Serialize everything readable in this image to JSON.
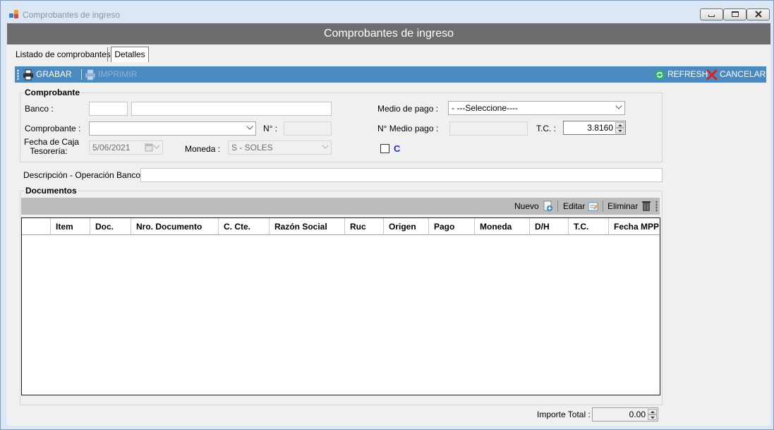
{
  "window": {
    "title": "Comprobantes de ingreso",
    "header": "Comprobantes de ingreso"
  },
  "tabs": {
    "listado": "Listado de comprobantes",
    "detalles": "Detalles"
  },
  "toolbar": {
    "grabar": "GRABAR",
    "imprimir": "IMPRIMIR",
    "refresh": "REFRESH",
    "cancelar": "CANCELAR"
  },
  "comprobante_group": {
    "title": "Comprobante",
    "banco_label": "Banco :",
    "banco_code": "",
    "banco_name": "",
    "comprobante_label": "Comprobante :",
    "comprobante_value": "",
    "numero_label": "N° :",
    "numero_value": "",
    "fecha_label_1": "Fecha de Caja",
    "fecha_label_2": "Tesorería:",
    "fecha_value": "5/06/2021",
    "moneda_label": "Moneda :",
    "moneda_value": "S - SOLES",
    "medio_pago_label": "Medio de pago :",
    "medio_pago_value": "- ---Seleccione----",
    "nro_medio_pago_label": "N° Medio pago :",
    "nro_medio_pago_value": "",
    "tc_label": "T.C. :",
    "tc_value": "3.8160",
    "c_checkbox_label": "C",
    "c_checked": false
  },
  "descripcion": {
    "label": "Descripción - Operación Banco:",
    "value": ""
  },
  "documentos": {
    "title": "Documentos",
    "nuevo": "Nuevo",
    "editar": "Editar",
    "eliminar": "Eliminar",
    "columns": [
      "Item",
      "Doc.",
      "Nro. Documento",
      "C. Cte.",
      "Razón Social",
      "Ruc",
      "Origen",
      "Pago",
      "Moneda",
      "D/H",
      "T.C.",
      "Fecha MPP"
    ],
    "rows": []
  },
  "footer": {
    "importe_total_label": "Importe Total :",
    "importe_total_value": "0.00"
  },
  "colors": {
    "header_bar": "#6d6d6d",
    "toolbar": "#4a8ac0",
    "checkbox_label": "#1a2ecc"
  }
}
